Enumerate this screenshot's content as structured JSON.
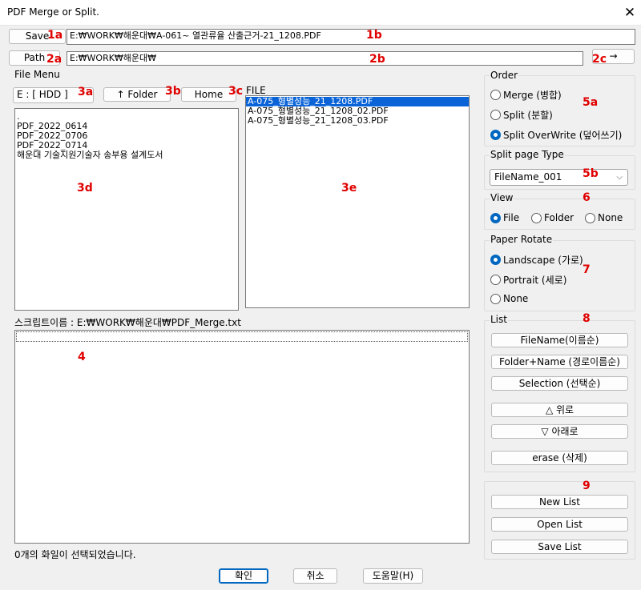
{
  "window": {
    "title": "PDF Merge or Split.",
    "close_glyph": "✕"
  },
  "save": {
    "button_label": "Save",
    "path_value": "E:₩WORK₩해운대₩A-061~ 열관류율 산출근거-21_1208.PDF"
  },
  "path": {
    "button_label": "Path",
    "value": "E:₩WORK₩해운대₩",
    "go_label": "→"
  },
  "file_menu": {
    "label": "File Menu",
    "drive": "E : [ HDD ]",
    "folder_up_label": "↑ Folder",
    "home_label": "Home",
    "folders": [
      ".",
      "PDF_2022_0614",
      "PDF_2022_0706",
      "PDF_2022_0714",
      "해운대 기술지원기술자 송부용 설계도서"
    ],
    "file_header": "FILE",
    "files": [
      "A-075_형별성능_21_1208.PDF",
      "A-075_형별성능_21_1208_02.PDF",
      "A-075_형별성능_21_1208_03.PDF"
    ]
  },
  "script": {
    "label": "스크립트이름 : E:₩WORK₩해운대₩PDF_Merge.txt"
  },
  "status": "0개의 화일이 선택되었습니다.",
  "order": {
    "label": "Order",
    "options": [
      "Merge (병합)",
      "Split (분할)",
      "Split OverWrite (덮어쓰기)"
    ],
    "selected": "Split OverWrite (덮어쓰기)"
  },
  "split_type": {
    "label": "Split page Type",
    "value": "FileName_001"
  },
  "view": {
    "label": "View",
    "options": [
      "File",
      "Folder",
      "None"
    ],
    "selected": "File"
  },
  "rotate": {
    "label": "Paper Rotate",
    "options": [
      "Landscape (가로)",
      "Portrait (세로)",
      "None"
    ],
    "selected": "Landscape (가로)"
  },
  "list": {
    "label": "List",
    "sort_buttons": [
      "FileName(이름순)",
      "Folder+Name (경로이름순)",
      "Selection (선택순)"
    ],
    "up_label": "△ 위로",
    "down_label": "▽ 아래로",
    "erase_label": "erase (삭제)"
  },
  "list_file": {
    "new_label": "New List",
    "open_label": "Open List",
    "save_label": "Save List"
  },
  "footer": {
    "ok": "확인",
    "cancel": "취소",
    "help": "도움말(H)"
  },
  "markers": {
    "m1a": "1a",
    "m1b": "1b",
    "m2a": "2a",
    "m2b": "2b",
    "m2c": "2c",
    "m3a": "3a",
    "m3b": "3b",
    "m3c": "3c",
    "m3d": "3d",
    "m3e": "3e",
    "m4": "4",
    "m5a": "5a",
    "m5b": "5b",
    "m6": "6",
    "m7": "7",
    "m8": "8",
    "m9": "9"
  },
  "colors": {
    "marker": "#e00000",
    "selection": "#0a64d8",
    "accent": "#0067c0"
  }
}
